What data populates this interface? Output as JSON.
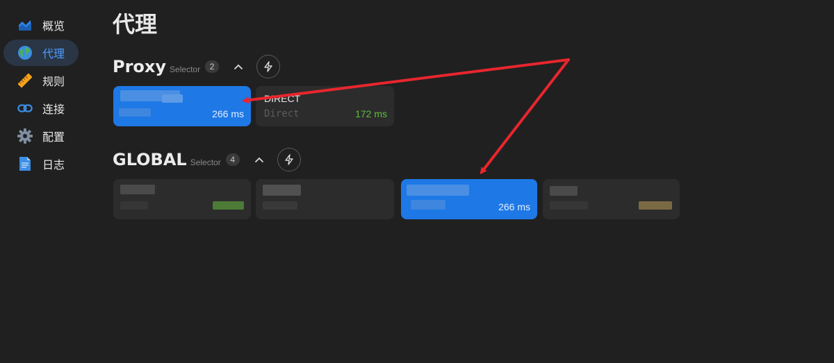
{
  "sidebar": {
    "items": [
      {
        "label": "概览",
        "icon": "chart-area-icon",
        "active": false
      },
      {
        "label": "代理",
        "icon": "globe-icon",
        "active": true
      },
      {
        "label": "规则",
        "icon": "ruler-icon",
        "active": false
      },
      {
        "label": "连接",
        "icon": "link-icon",
        "active": false
      },
      {
        "label": "配置",
        "icon": "gear-icon",
        "active": false
      },
      {
        "label": "日志",
        "icon": "document-icon",
        "active": false
      }
    ]
  },
  "page": {
    "title": "代理"
  },
  "groups": [
    {
      "name": "Proxy",
      "type": "Selector",
      "count": "2",
      "proxies": [
        {
          "name": "",
          "type": "",
          "delay": "266 ms",
          "delay_color": "#e3efff",
          "selected": true,
          "redacted": true
        },
        {
          "name": "DIRECT",
          "type": "Direct",
          "delay": "172 ms",
          "delay_color": "#5fbf3f",
          "selected": false,
          "redacted": false
        }
      ]
    },
    {
      "name": "GLOBAL",
      "type": "Selector",
      "count": "4",
      "proxies": [
        {
          "name": "",
          "type": "",
          "delay": "",
          "selected": false,
          "redacted": true
        },
        {
          "name": "",
          "type": "",
          "delay": "",
          "selected": false,
          "redacted": true
        },
        {
          "name": "",
          "type": "",
          "delay": "266 ms",
          "delay_color": "#e3efff",
          "selected": true,
          "redacted": true
        },
        {
          "name": "",
          "type": "",
          "delay": "",
          "selected": false,
          "redacted": true
        }
      ]
    }
  ],
  "colors": {
    "background": "#202020",
    "card": "#2c2c2c",
    "selected": "#1e78e6",
    "accent_text": "#4e9cff",
    "annotation_arrow": "#e8262d",
    "latency_good": "#5fbf3f"
  }
}
